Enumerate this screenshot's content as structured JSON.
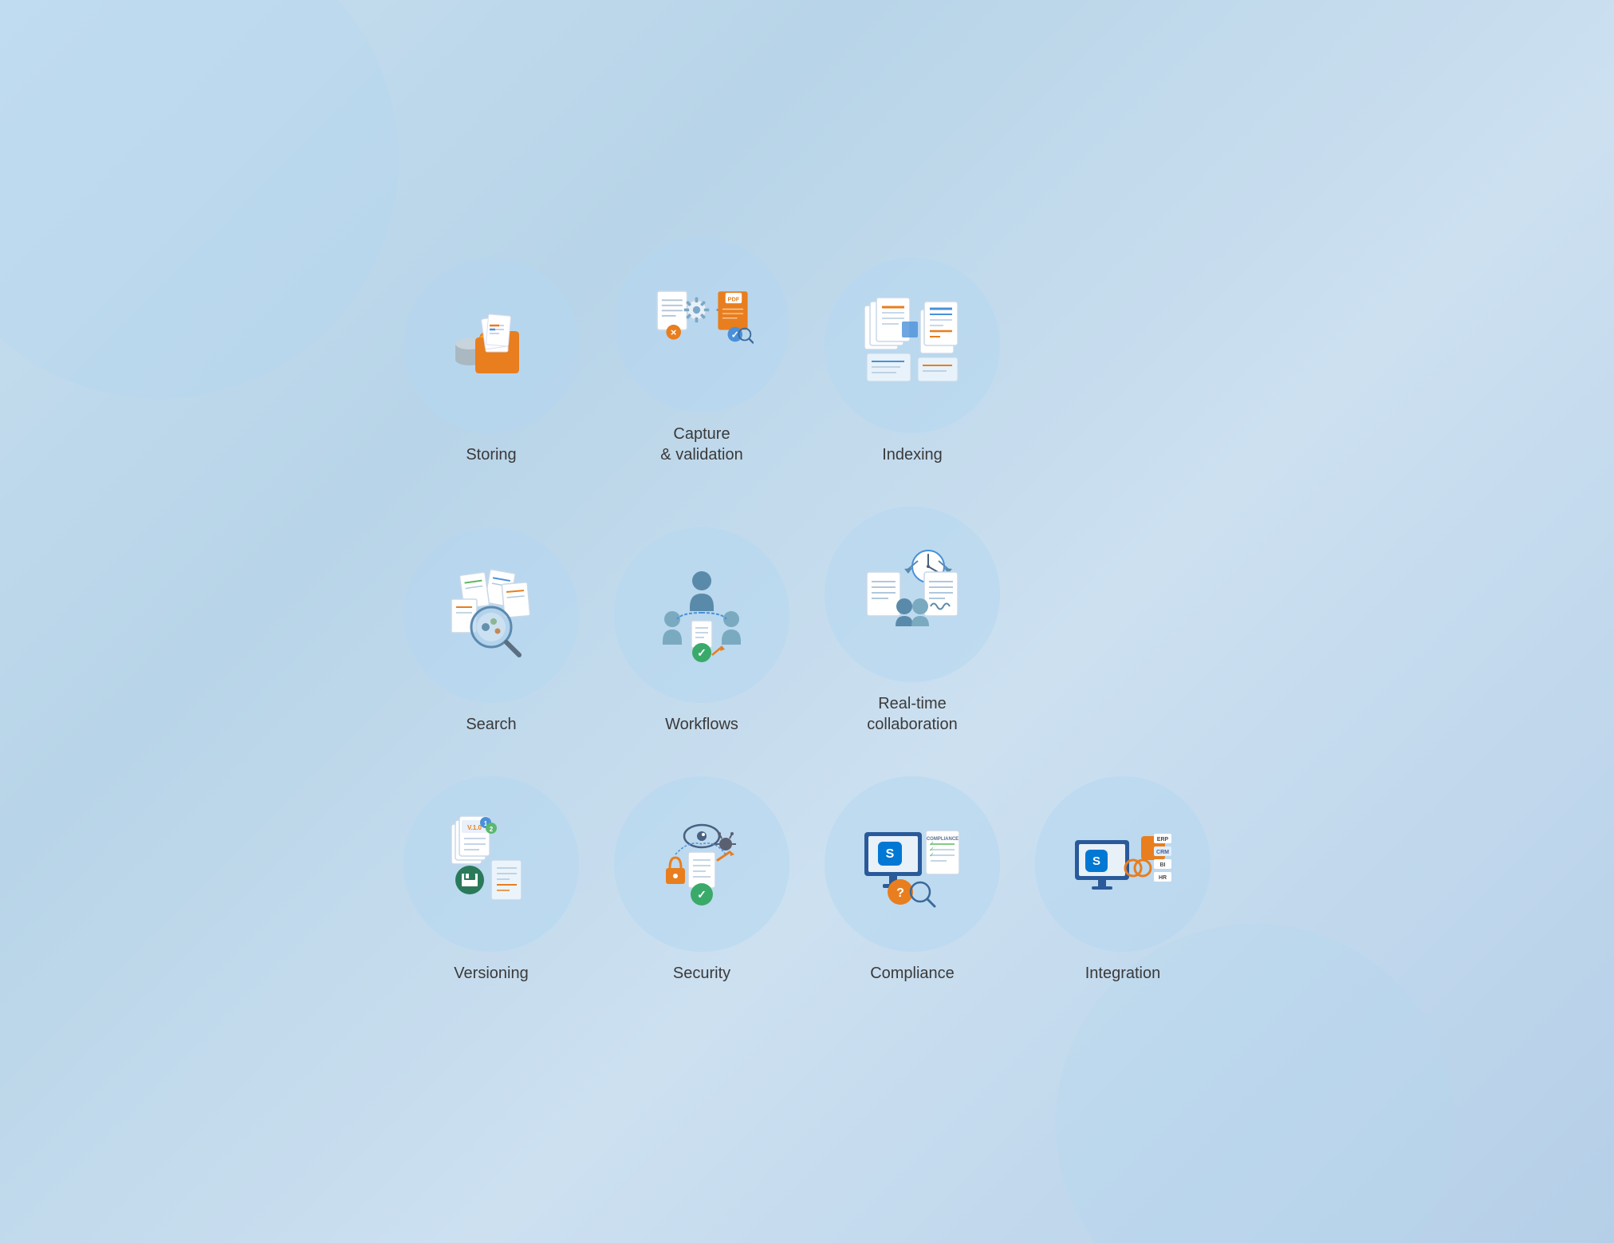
{
  "cards": [
    {
      "id": "storing",
      "label": "Storing",
      "row": 1
    },
    {
      "id": "capture-validation",
      "label": "Capture\n& validation",
      "row": 1
    },
    {
      "id": "indexing",
      "label": "Indexing",
      "row": 1
    },
    {
      "id": "search",
      "label": "Search",
      "row": 2
    },
    {
      "id": "workflows",
      "label": "Workflows",
      "row": 2
    },
    {
      "id": "realtime-collaboration",
      "label": "Real-time\ncollaboration",
      "row": 2
    },
    {
      "id": "versioning",
      "label": "Versioning",
      "row": 3
    },
    {
      "id": "security",
      "label": "Security",
      "row": 3
    },
    {
      "id": "compliance",
      "label": "Compliance",
      "row": 3
    },
    {
      "id": "integration",
      "label": "Integration",
      "row": 3
    }
  ]
}
